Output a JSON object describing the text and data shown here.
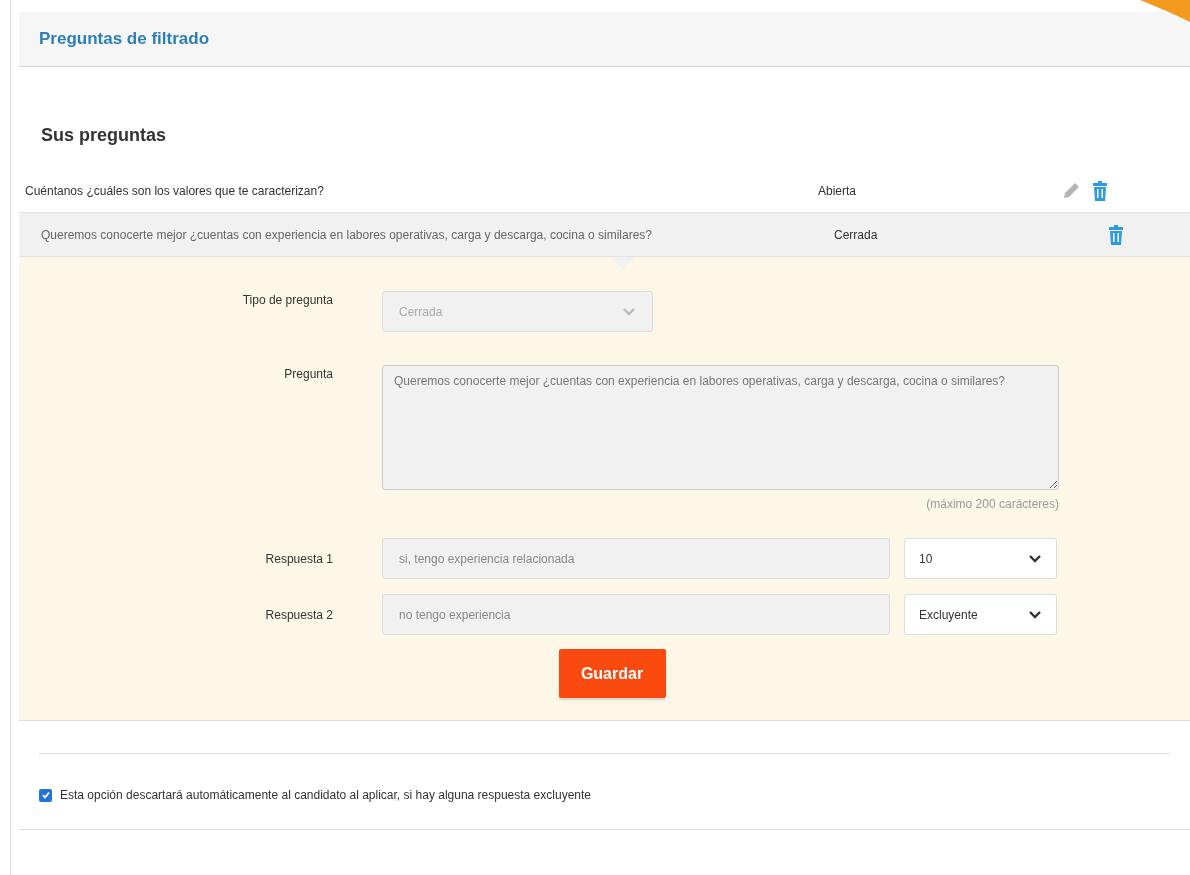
{
  "header": {
    "title": "Preguntas de filtrado"
  },
  "section_title": "Sus preguntas",
  "questions": [
    {
      "text": "Cuéntanos ¿cuáles son los valores que te caracterizan?",
      "type": "Abierta",
      "selected": false,
      "editable": true
    },
    {
      "text": "Queremos conocerte mejor ¿cuentas con experiencia en labores operativas, carga y descarga, cocina o similares?",
      "type": "Cerrada",
      "selected": true,
      "editable": false
    }
  ],
  "form": {
    "type_label": "Tipo de pregunta",
    "type_value": "Cerrada",
    "question_label": "Pregunta",
    "question_value": "Queremos conocerte mejor ¿cuentas con experiencia en labores operativas, carga y descarga, cocina o similares?",
    "hint": "(máximo 200 carácteres)",
    "answers": [
      {
        "label": "Respuesta 1",
        "value": "si, tengo experiencia relacionada",
        "score": "10"
      },
      {
        "label": "Respuesta 2",
        "value": "no tengo experiencia",
        "score": "Excluyente"
      }
    ],
    "save": "Guardar"
  },
  "auto_discard": {
    "checked": true,
    "label": "Esta opción descartará automáticamente al candidato al aplicar, si hay alguna respuesta excluyente"
  }
}
